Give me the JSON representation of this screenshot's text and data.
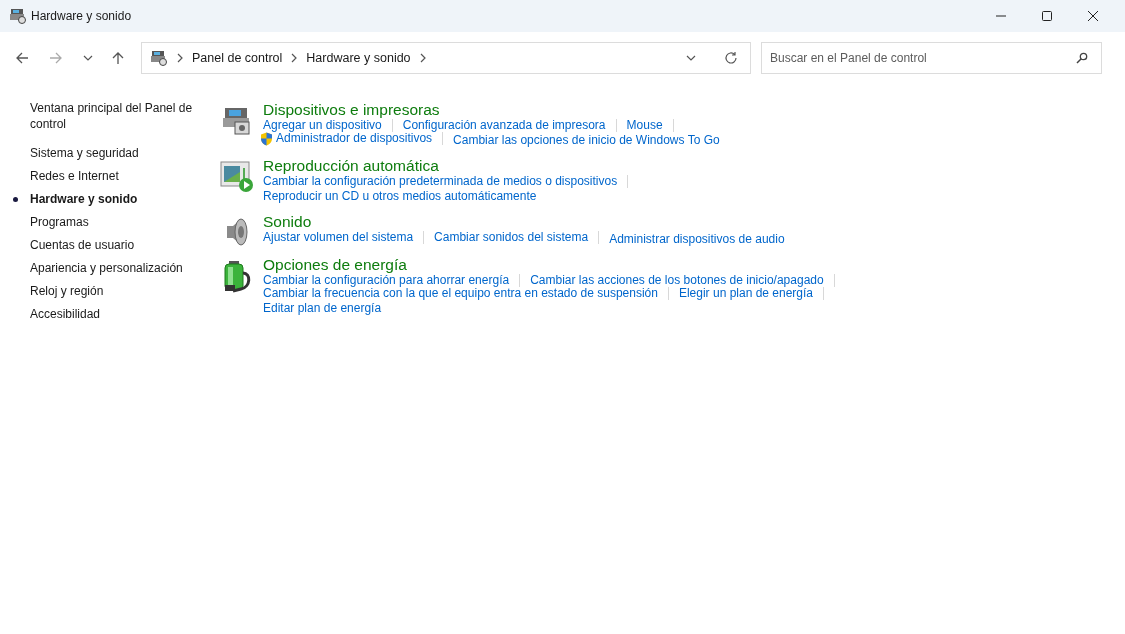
{
  "window": {
    "title": "Hardware y sonido"
  },
  "address_bar": {
    "crumbs": [
      "Panel de control",
      "Hardware y sonido"
    ]
  },
  "search": {
    "placeholder": "Buscar en el Panel de control"
  },
  "sidebar": {
    "items": [
      {
        "label": "Ventana principal del Panel de control",
        "selected": false
      },
      {
        "label": "Sistema y seguridad",
        "selected": false
      },
      {
        "label": "Redes e Internet",
        "selected": false
      },
      {
        "label": "Hardware y sonido",
        "selected": true
      },
      {
        "label": "Programas",
        "selected": false
      },
      {
        "label": "Cuentas de usuario",
        "selected": false
      },
      {
        "label": "Apariencia y personalización",
        "selected": false
      },
      {
        "label": "Reloj y región",
        "selected": false
      },
      {
        "label": "Accesibilidad",
        "selected": false
      }
    ]
  },
  "categories": [
    {
      "kind": "printer",
      "title": "Dispositivos e impresoras",
      "rows": [
        [
          {
            "label": "Agregar un dispositivo",
            "shield": false
          },
          {
            "label": "Configuración avanzada de impresora",
            "shield": false
          },
          {
            "label": "Mouse",
            "shield": false
          }
        ],
        [
          {
            "label": "Administrador de dispositivos",
            "shield": true
          },
          {
            "label": "Cambiar las opciones de inicio de Windows To Go",
            "shield": false
          }
        ]
      ]
    },
    {
      "kind": "autoplay",
      "title": "Reproducción automática",
      "rows": [
        [
          {
            "label": "Cambiar la configuración predeterminada de medios o dispositivos",
            "shield": false
          }
        ],
        [
          {
            "label": "Reproducir un CD u otros medios automáticamente",
            "shield": false
          }
        ]
      ]
    },
    {
      "kind": "speaker",
      "title": "Sonido",
      "rows": [
        [
          {
            "label": "Ajustar volumen del sistema",
            "shield": false
          },
          {
            "label": "Cambiar sonidos del sistema",
            "shield": false
          },
          {
            "label": "Administrar dispositivos de audio",
            "shield": false
          }
        ]
      ]
    },
    {
      "kind": "power",
      "title": "Opciones de energía",
      "rows": [
        [
          {
            "label": "Cambiar la configuración para ahorrar energía",
            "shield": false
          },
          {
            "label": "Cambiar las acciones de los botones de inicio/apagado",
            "shield": false
          }
        ],
        [
          {
            "label": "Cambiar la frecuencia con la que el equipo entra en estado de suspensión",
            "shield": false
          },
          {
            "label": "Elegir un plan de energía",
            "shield": false
          }
        ],
        [
          {
            "label": "Editar plan de energía",
            "shield": false
          }
        ]
      ]
    }
  ]
}
